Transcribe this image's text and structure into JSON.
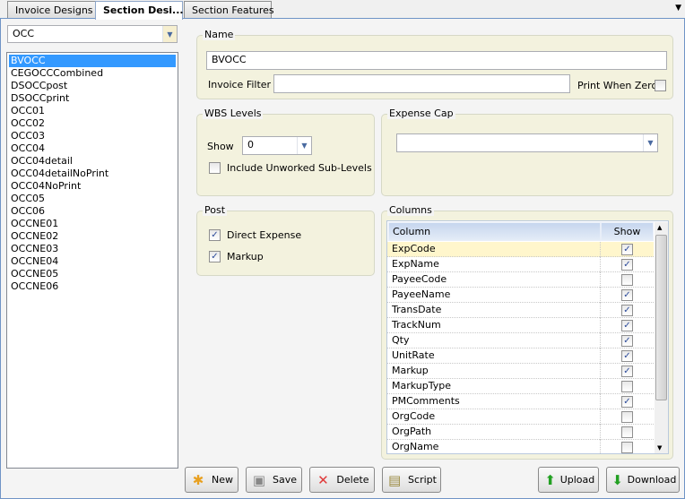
{
  "tabs": [
    {
      "label": "Invoice Designs"
    },
    {
      "label": "Section Desi..."
    },
    {
      "label": "Section Features"
    }
  ],
  "category_select": {
    "value": "OCC"
  },
  "sections": [
    "BVOCC",
    "CEGOCCCombined",
    "DSOCCpost",
    "DSOCCprint",
    "OCC01",
    "OCC02",
    "OCC03",
    "OCC04",
    "OCC04detail",
    "OCC04detailNoPrint",
    "OCC04NoPrint",
    "OCC05",
    "OCC06",
    "OCCNE01",
    "OCCNE02",
    "OCCNE03",
    "OCCNE04",
    "OCCNE05",
    "OCCNE06"
  ],
  "selected_section": "BVOCC",
  "name_group": {
    "legend": "Name",
    "name_value": "BVOCC",
    "invoice_filter_label": "Invoice Filter",
    "invoice_filter_value": "",
    "print_when_zero_label": "Print When Zero",
    "print_when_zero": false
  },
  "wbs": {
    "legend": "WBS Levels",
    "show_label": "Show",
    "show_value": "0",
    "include_label": "Include Unworked Sub-Levels",
    "include": false
  },
  "expense_cap": {
    "legend": "Expense Cap",
    "value": ""
  },
  "post": {
    "legend": "Post",
    "direct_expense_label": "Direct Expense",
    "direct_expense": true,
    "markup_label": "Markup",
    "markup": true
  },
  "columns": {
    "legend": "Columns",
    "header_column": "Column",
    "header_show": "Show",
    "rows": [
      {
        "name": "ExpCode",
        "show": true
      },
      {
        "name": "ExpName",
        "show": true
      },
      {
        "name": "PayeeCode",
        "show": false
      },
      {
        "name": "PayeeName",
        "show": true
      },
      {
        "name": "TransDate",
        "show": true
      },
      {
        "name": "TrackNum",
        "show": true
      },
      {
        "name": "Qty",
        "show": true
      },
      {
        "name": "UnitRate",
        "show": true
      },
      {
        "name": "Markup",
        "show": true
      },
      {
        "name": "MarkupType",
        "show": false
      },
      {
        "name": "PMComments",
        "show": true
      },
      {
        "name": "OrgCode",
        "show": false
      },
      {
        "name": "OrgPath",
        "show": false
      },
      {
        "name": "OrgName",
        "show": false
      }
    ]
  },
  "buttons": {
    "new": "New",
    "save": "Save",
    "delete": "Delete",
    "script": "Script",
    "upload": "Upload",
    "download": "Download"
  }
}
